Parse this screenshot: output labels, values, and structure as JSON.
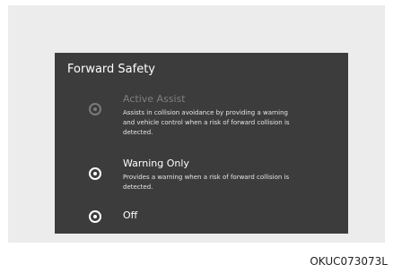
{
  "screen": {
    "title": "Forward Safety",
    "options": [
      {
        "label": "Active Assist",
        "description": "Assists in collision avoidance by providing a warning and vehicle control when a risk of forward collision is detected.",
        "selected": true,
        "disabled": true
      },
      {
        "label": "Warning Only",
        "description": "Provides a warning when a risk of forward collision is detected.",
        "selected": false,
        "disabled": false
      },
      {
        "label": "Off",
        "description": "",
        "selected": false,
        "disabled": false
      }
    ]
  },
  "caption": "OKUC073073L"
}
